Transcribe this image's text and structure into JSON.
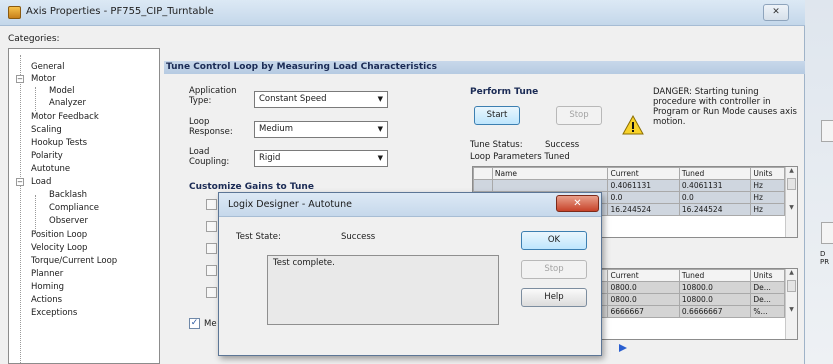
{
  "window": {
    "title": "Axis Properties - PF755_CIP_Turntable",
    "close_glyph": "✕"
  },
  "categories_label": "Categories:",
  "tree": {
    "items": [
      {
        "label": "General"
      },
      {
        "label": "Motor"
      },
      {
        "label": "Model"
      },
      {
        "label": "Analyzer"
      },
      {
        "label": "Motor Feedback"
      },
      {
        "label": "Scaling"
      },
      {
        "label": "Hookup Tests"
      },
      {
        "label": "Polarity"
      },
      {
        "label": "Autotune"
      },
      {
        "label": "Load"
      },
      {
        "label": "Backlash"
      },
      {
        "label": "Compliance"
      },
      {
        "label": "Observer"
      },
      {
        "label": "Position Loop"
      },
      {
        "label": "Velocity Loop"
      },
      {
        "label": "Torque/Current Loop"
      },
      {
        "label": "Planner"
      },
      {
        "label": "Homing"
      },
      {
        "label": "Actions"
      },
      {
        "label": "Exceptions"
      }
    ]
  },
  "panel": {
    "header": "Tune Control Loop by Measuring Load Characteristics",
    "application_type_label": "Application Type:",
    "application_type_value": "Constant Speed",
    "loop_response_label": "Loop Response:",
    "loop_response_value": "Medium",
    "load_coupling_label": "Load Coupling:",
    "load_coupling_value": "Rigid",
    "customize_gains_label": "Customize Gains to Tune",
    "measure_label_fragment": "Me",
    "perform_tune_label": "Perform Tune",
    "start_button": "Start",
    "stop_button": "Stop",
    "danger_text": "DANGER: Starting tuning procedure with controller in Program or Run Mode causes axis motion.",
    "tune_status_label": "Tune Status:",
    "tune_status_value": "Success",
    "loop_params_label": "Loop Parameters Tuned"
  },
  "table1": {
    "headers": [
      "Name",
      "Current",
      "Tuned",
      "Units"
    ],
    "rows": [
      {
        "current": "0.4061131",
        "tuned": "0.4061131",
        "units": "Hz"
      },
      {
        "current": "0.0",
        "tuned": "0.0",
        "units": "Hz"
      },
      {
        "current": "16.244524",
        "tuned": "16.244524",
        "units": "Hz"
      }
    ]
  },
  "table2": {
    "headers": [
      "Current",
      "Tuned",
      "Units"
    ],
    "rows": [
      {
        "current": "0800.0",
        "tuned": "10800.0",
        "units": "De..."
      },
      {
        "current": "0800.0",
        "tuned": "10800.0",
        "units": "De..."
      },
      {
        "current": "6666667",
        "tuned": "0.6666667",
        "units": "%..."
      }
    ]
  },
  "side_edge": {
    "label": "D PR"
  },
  "modal": {
    "title": "Logix Designer - Autotune",
    "close_glyph": "✕",
    "test_state_label": "Test State:",
    "test_state_value": "Success",
    "message": "Test complete.",
    "ok_button": "OK",
    "stop_button": "Stop",
    "help_button": "Help"
  }
}
